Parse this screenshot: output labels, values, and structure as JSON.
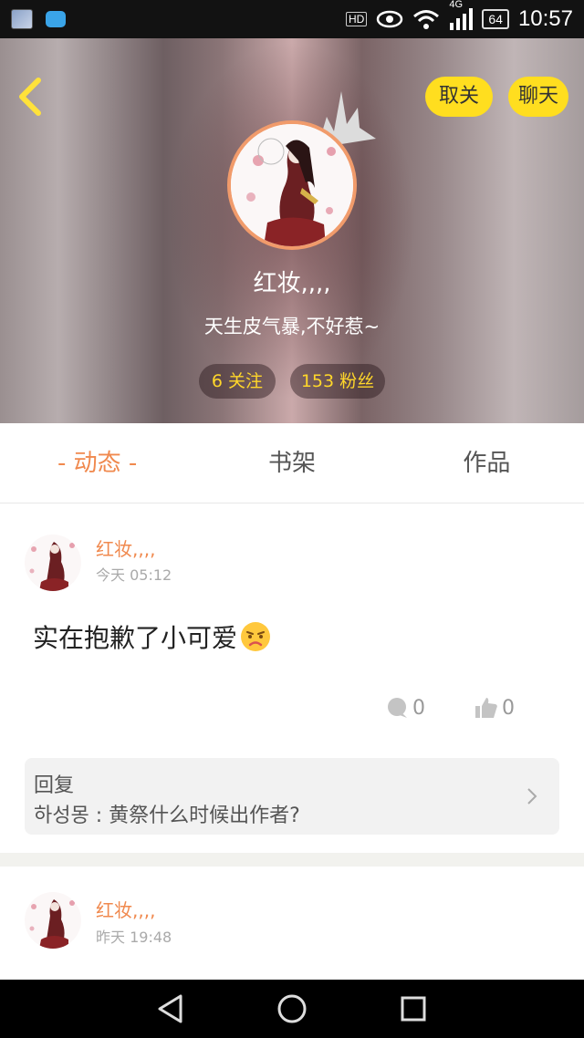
{
  "status_bar": {
    "hd_label": "HD",
    "network_label": "4G",
    "battery": "64",
    "time": "10:57"
  },
  "header": {
    "unfollow_label": "取关",
    "chat_label": "聊天",
    "nickname": "红妆,,,,",
    "signature": "天生皮气暴,不好惹~",
    "following_label": "6 关注",
    "followers_label": "153 粉丝"
  },
  "tabs": [
    {
      "label": "- 动态 -",
      "active": true
    },
    {
      "label": "书架",
      "active": false
    },
    {
      "label": "作品",
      "active": false
    }
  ],
  "posts": [
    {
      "author": "红妆,,,,",
      "time": "今天 05:12",
      "text": "实在抱歉了小可爱",
      "comments": "0",
      "likes": "0",
      "reply_label": "回复",
      "reply_text": "하성몽 : 黄祭什么时候出作者?"
    },
    {
      "author": "红妆,,,,",
      "time": "昨天 19:48"
    }
  ],
  "colors": {
    "accent": "#f0894e",
    "pill_yellow": "#ffde1f",
    "stat_text": "#ffd72a"
  },
  "icons": [
    "back-arrow-icon",
    "crown-icon",
    "comment-icon",
    "like-icon",
    "chevron-right-icon",
    "nav-back-icon",
    "nav-home-icon",
    "nav-recents-icon"
  ]
}
